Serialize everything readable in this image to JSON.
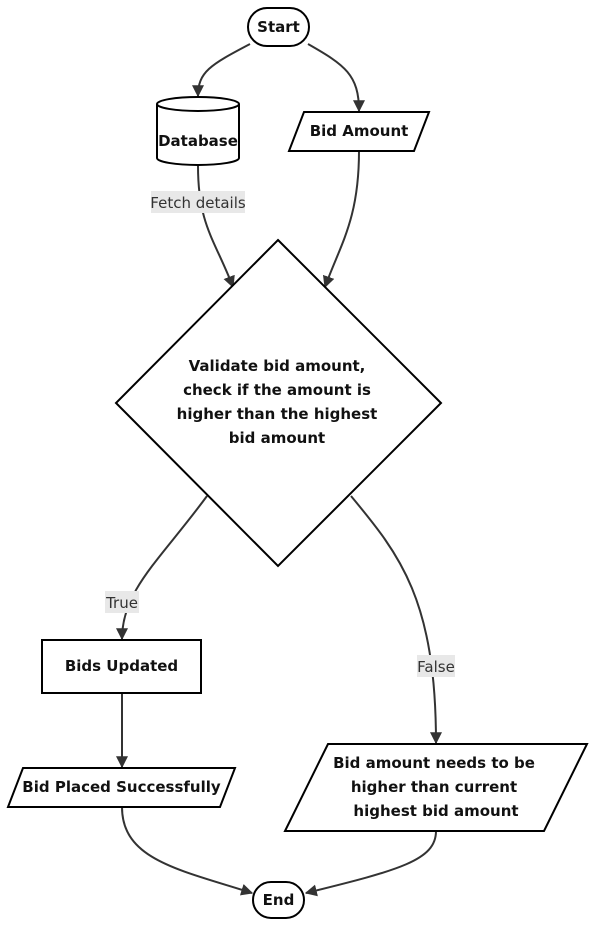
{
  "nodes": {
    "start": "Start",
    "database": "Database",
    "bid_amount": "Bid Amount",
    "decision": [
      "Validate bid amount,",
      "check if the amount is",
      "higher than the highest",
      "bid amount"
    ],
    "bids_updated": "Bids Updated",
    "bid_placed": "Bid Placed Successfully",
    "bid_error": [
      "Bid amount needs to be",
      "higher than current",
      "highest bid amount"
    ],
    "end": "End"
  },
  "edges": {
    "fetch_details": "Fetch details",
    "true_label": "True",
    "false_label": "False"
  },
  "colors": {
    "stroke": "#000000",
    "edge": "#333333",
    "label_bg": "#e8e8e8"
  }
}
